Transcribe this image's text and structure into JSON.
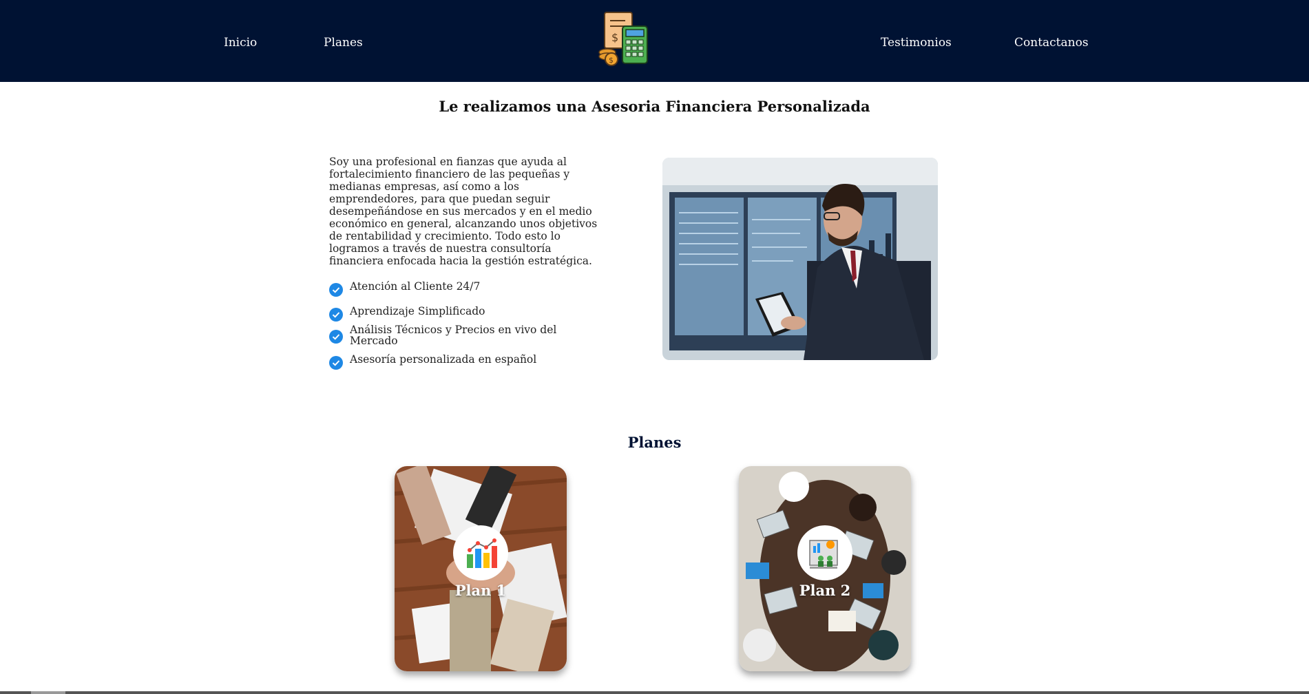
{
  "nav": {
    "inicio": "Inicio",
    "planes": "Planes",
    "testimonios": "Testimonios",
    "contactanos": "Contactanos",
    "logo_icon": "calculator-invoice-coins-icon"
  },
  "hero": {
    "title": "Le realizamos una Asesoria Financiera Personalizada",
    "description": "Soy una profesional en fianzas que ayuda al fortalecimiento financiero de las pequeñas y medianas empresas, así como a los emprendedores, para que puedan seguir desempeñándose en sus mercados y en el medio económico en general, alcanzando unos objetivos de rentabilidad y crecimiento. Todo esto lo logramos a través de nuestra consultoría financiera enfocada hacia la gestión estratégica.",
    "features": [
      "Atención al Cliente 24/7",
      "Aprendizaje Simplificado",
      "Análisis Técnicos y Precios en vivo del Mercado",
      "Asesoría personalizada en español"
    ],
    "check_color": "#1e88e5"
  },
  "plans": {
    "title": "Planes",
    "items": [
      {
        "label": "Plan 1",
        "icon": "bar-line-chart-icon"
      },
      {
        "label": "Plan 2",
        "icon": "business-presentation-icon"
      }
    ]
  },
  "colors": {
    "navbar": "#001233",
    "plans_title": "#001233"
  }
}
